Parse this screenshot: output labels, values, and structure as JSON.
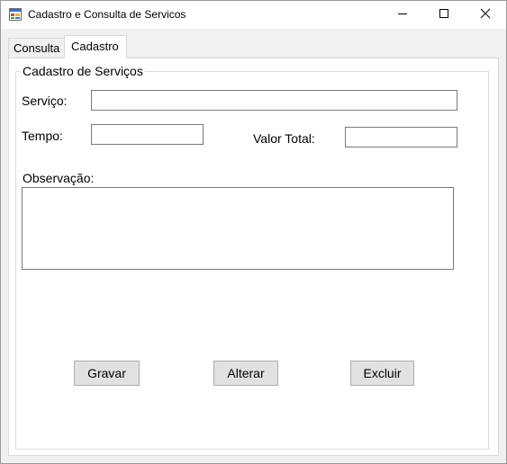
{
  "window": {
    "title": "Cadastro e Consulta de Servicos"
  },
  "tabs": [
    {
      "label": "Consulta",
      "active": false
    },
    {
      "label": "Cadastro",
      "active": true
    }
  ],
  "form": {
    "group_title": "Cadastro de Serviços",
    "servico_label": "Serviço:",
    "servico_value": "",
    "tempo_label": "Tempo:",
    "tempo_value": "",
    "valor_total_label": "Valor Total:",
    "valor_total_value": "",
    "observacao_label": "Observação:",
    "observacao_value": ""
  },
  "buttons": {
    "gravar": "Gravar",
    "alterar": "Alterar",
    "excluir": "Excluir"
  },
  "icons": {
    "app": "app-window-icon",
    "minimize": "minimize-icon",
    "maximize": "maximize-icon",
    "close": "close-icon"
  }
}
